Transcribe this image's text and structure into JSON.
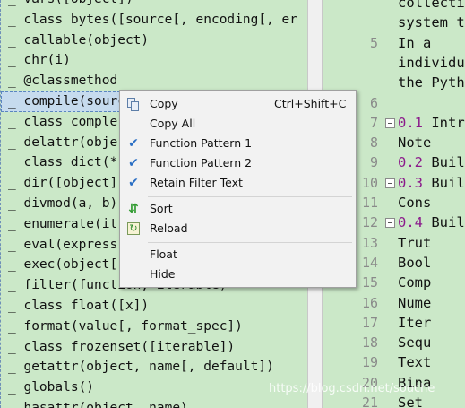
{
  "function_list": [
    {
      "text": "_ vars([object])"
    },
    {
      "text": "_ class bytes([source[, encoding[, er"
    },
    {
      "text": "_ callable(object)"
    },
    {
      "text": "_ chr(i)"
    },
    {
      "text": "_ @classmethod"
    },
    {
      "text": "_ compile(sourc",
      "selected": true
    },
    {
      "text": "_ class comple"
    },
    {
      "text": "_ delattr(obje"
    },
    {
      "text": "_ class dict(*"
    },
    {
      "text": "_ dir([object]"
    },
    {
      "text": "_ divmod(a, b)"
    },
    {
      "text": "_ enumerate(it"
    },
    {
      "text": "_ eval(express"
    },
    {
      "text": "_ exec(object["
    },
    {
      "text": "_ filter(function, iterable)"
    },
    {
      "text": "_ class float([x])"
    },
    {
      "text": "_ format(value[, format_spec])"
    },
    {
      "text": "_ class frozenset([iterable])"
    },
    {
      "text": "_ getattr(object, name[, default])"
    },
    {
      "text": "_ globals()"
    },
    {
      "text": "_ hasattr(object, name)"
    }
  ],
  "editor": {
    "lines": [
      {
        "ln": "",
        "fold": false,
        "num": "",
        "text": "collecti"
      },
      {
        "ln": "",
        "fold": false,
        "num": "",
        "text": "system t"
      },
      {
        "ln": "5",
        "fold": false,
        "num": "",
        "text": "  In a"
      },
      {
        "ln": "",
        "fold": false,
        "num": "",
        "text": "individu"
      },
      {
        "ln": "",
        "fold": false,
        "num": "",
        "text": "the Pyth"
      },
      {
        "ln": "6",
        "fold": false,
        "num": "",
        "text": ""
      },
      {
        "ln": "7",
        "fold": true,
        "num": "0.1",
        "text": " Intr"
      },
      {
        "ln": "8",
        "fold": false,
        "num": "",
        "text": "    Note"
      },
      {
        "ln": "9",
        "fold": false,
        "num": "0.2",
        "text": " Buil"
      },
      {
        "ln": "10",
        "fold": true,
        "num": "0.3",
        "text": " Buil"
      },
      {
        "ln": "11",
        "fold": false,
        "num": "",
        "text": "    Cons"
      },
      {
        "ln": "12",
        "fold": true,
        "num": "0.4",
        "text": " Buil"
      },
      {
        "ln": "13",
        "fold": false,
        "num": "",
        "text": "    Trut"
      },
      {
        "ln": "14",
        "fold": false,
        "num": "",
        "text": "    Bool"
      },
      {
        "ln": "15",
        "fold": false,
        "num": "",
        "text": "    Comp"
      },
      {
        "ln": "16",
        "fold": false,
        "num": "",
        "text": "    Nume"
      },
      {
        "ln": "17",
        "fold": false,
        "num": "",
        "text": "    Iter"
      },
      {
        "ln": "18",
        "fold": false,
        "num": "",
        "text": "    Sequ"
      },
      {
        "ln": "19",
        "fold": false,
        "num": "",
        "text": "    Text"
      },
      {
        "ln": "20",
        "fold": false,
        "num": "",
        "text": "    Bina"
      },
      {
        "ln": "21",
        "fold": false,
        "num": "",
        "text": "    Set"
      }
    ]
  },
  "context_menu": {
    "items": [
      {
        "type": "item",
        "label": "Copy",
        "shortcut": "Ctrl+Shift+C",
        "icon": "copy-icon"
      },
      {
        "type": "item",
        "label": "Copy All",
        "shortcut": "",
        "icon": ""
      },
      {
        "type": "item",
        "label": "Function Pattern 1",
        "shortcut": "",
        "icon": "check-icon"
      },
      {
        "type": "item",
        "label": "Function Pattern 2",
        "shortcut": "",
        "icon": "check-icon"
      },
      {
        "type": "item",
        "label": "Retain Filter Text",
        "shortcut": "",
        "icon": "check-icon"
      },
      {
        "type": "separator"
      },
      {
        "type": "item",
        "label": "Sort",
        "shortcut": "",
        "icon": "sort-icon"
      },
      {
        "type": "item",
        "label": "Reload",
        "shortcut": "",
        "icon": "reload-icon"
      },
      {
        "type": "separator"
      },
      {
        "type": "item",
        "label": "Float",
        "shortcut": "",
        "icon": ""
      },
      {
        "type": "item",
        "label": "Hide",
        "shortcut": "",
        "icon": ""
      }
    ]
  },
  "watermark": "https://blog.csdn.net/souche",
  "colors": {
    "pane_bg": "#cbe8c8",
    "selection": "#c6dbee",
    "check": "#2b6fc4",
    "number": "#8b1a8b"
  }
}
